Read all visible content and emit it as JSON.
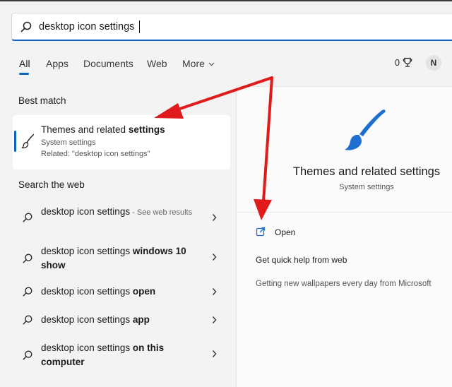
{
  "search": {
    "value": "desktop icon settings",
    "icon": "search-icon"
  },
  "tabs": [
    {
      "label": "All",
      "active": true
    },
    {
      "label": "Apps"
    },
    {
      "label": "Documents"
    },
    {
      "label": "Web"
    },
    {
      "label": "More"
    }
  ],
  "header_right": {
    "points": "0",
    "points_icon": "rewards-trophy-icon",
    "avatar_initial": "N"
  },
  "best_match": {
    "header": "Best match",
    "title_plain": "Themes and related ",
    "title_bold": "settings",
    "subtitle": "System settings",
    "related": "Related: \"desktop icon settings\"",
    "icon": "paintbrush-icon"
  },
  "search_web": {
    "header": "Search the web",
    "items": [
      {
        "text": "desktop icon settings",
        "bold": "",
        "suffix": " - See web results"
      },
      {
        "text": "desktop icon settings ",
        "bold": "windows 10 show",
        "suffix": ""
      },
      {
        "text": "desktop icon settings ",
        "bold": "open",
        "suffix": ""
      },
      {
        "text": "desktop icon settings ",
        "bold": "app",
        "suffix": ""
      },
      {
        "text": "desktop icon settings ",
        "bold": "on this computer",
        "suffix": ""
      }
    ]
  },
  "detail_panel": {
    "title": "Themes and related settings",
    "subtitle": "System settings",
    "open_label": "Open",
    "help_header": "Get quick help from web",
    "help_link": "Getting new wallpapers every day from Microsoft"
  },
  "colors": {
    "accent": "#0a64c8",
    "arrow": "#e01b1b"
  }
}
